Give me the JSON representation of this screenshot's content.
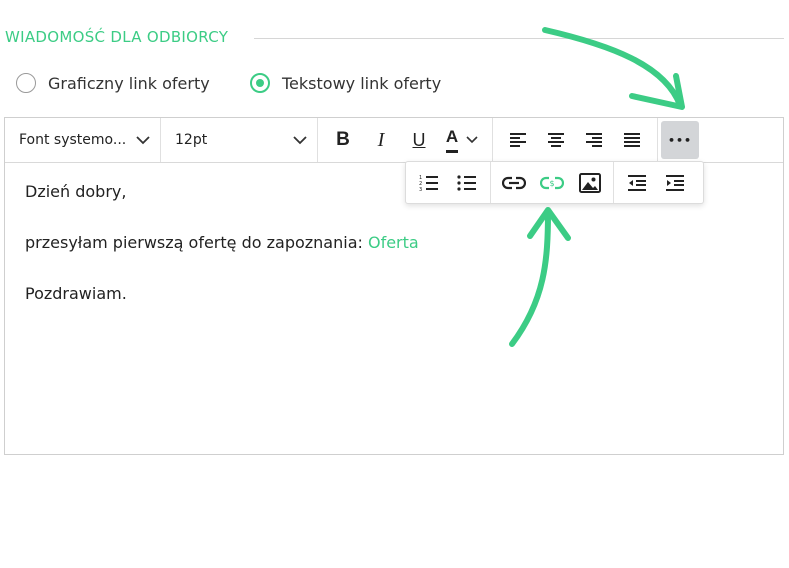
{
  "section": {
    "title": "WIADOMOŚĆ DLA ODBIORCY"
  },
  "radios": [
    {
      "label": "Graficzny link oferty",
      "checked": false
    },
    {
      "label": "Tekstowy link oferty",
      "checked": true
    }
  ],
  "toolbar": {
    "font_select": "Font systemo...",
    "size_select": "12pt",
    "bold_label": "B",
    "italic_label": "I",
    "underline_label": "U",
    "text_color_label": "A",
    "more_label": "•••"
  },
  "editor": {
    "line1": "Dzień dobry,",
    "line2_text": "przesyłam pierwszą ofertę do zapoznania: ",
    "line2_link": "Oferta",
    "line3": "Pozdrawiam."
  },
  "colors": {
    "accent": "#3ccc85",
    "text_color_underline": "#222222",
    "more_button_bg": "#d3d5d8"
  },
  "icons": {
    "toolbar": [
      "chevron-down-icon",
      "bold-icon",
      "italic-icon",
      "underline-icon",
      "text-color-icon",
      "align-left-icon",
      "align-center-icon",
      "align-right-icon",
      "align-justify-icon",
      "more-icon"
    ],
    "overflow": [
      "numbered-list-icon",
      "bullet-list-icon",
      "link-icon",
      "offer-link-icon",
      "image-icon",
      "outdent-icon",
      "indent-icon"
    ]
  }
}
